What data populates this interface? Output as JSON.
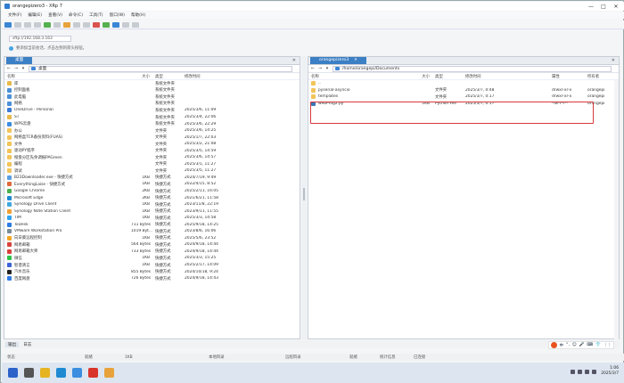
{
  "window": {
    "title": "orangepizero3 - XRp 7"
  },
  "menu": [
    "文件(F)",
    "编辑(E)",
    "查看(V)",
    "命令(C)",
    "工具(T)",
    "窗口(W)",
    "帮助(H)"
  ],
  "address": {
    "value": "sftp://192.168.3.163"
  },
  "hint": {
    "text": "要添加当前会话，点击左侧的箭头按钮。"
  },
  "left_pane": {
    "tab": "桌面",
    "path": "桌面",
    "columns": {
      "name": "名称",
      "size": "大小",
      "type": "类型",
      "modified": "修改时间"
    },
    "rows": [
      {
        "name": "库",
        "size": "",
        "type": "系统文件夹",
        "modified": "",
        "color": "#e8b84a"
      },
      {
        "name": "控制面板",
        "size": "",
        "type": "系统文件夹",
        "modified": "",
        "color": "#4a8fd8"
      },
      {
        "name": "此电脑",
        "size": "",
        "type": "系统文件夹",
        "modified": "",
        "color": "#4a8fd8"
      },
      {
        "name": "网络",
        "size": "",
        "type": "系统文件夹",
        "modified": "",
        "color": "#4a8fd8"
      },
      {
        "name": "OneDrive - Personal",
        "size": "",
        "type": "系统文件夹",
        "modified": "2025/3/6, 11:09",
        "color": "#3a7bd5"
      },
      {
        "name": "ST",
        "size": "",
        "type": "系统文件夹",
        "modified": "2025/3/4, 22:06",
        "color": "#e8b84a"
      },
      {
        "name": "WPS云盘",
        "size": "",
        "type": "系统文件夹",
        "modified": "2025/3/6, 22:29",
        "color": "#3b8ee0"
      },
      {
        "name": "办公",
        "size": "",
        "type": "文件夹",
        "modified": "2025/3/6, 14:25",
        "color": "#f2c45a"
      },
      {
        "name": "网络盒TCR备份资料(FUAS)",
        "size": "",
        "type": "文件夹",
        "modified": "2025/1/7, 22:03",
        "color": "#f2c45a"
      },
      {
        "name": "文件",
        "size": "",
        "type": "文件夹",
        "modified": "2025/3/2, 21:08",
        "color": "#f2c45a"
      },
      {
        "name": "驱动PY程序",
        "size": "",
        "type": "文件夹",
        "modified": "2025/3/5, 14:59",
        "color": "#f2c45a"
      },
      {
        "name": "橙盘分区先余调报PAGreen",
        "size": "",
        "type": "文件夹",
        "modified": "2025/3/6, 14:57",
        "color": "#f2c45a"
      },
      {
        "name": "编程",
        "size": "",
        "type": "文件夹",
        "modified": "2025/3/1, 11:27",
        "color": "#f2c45a"
      },
      {
        "name": "调试",
        "size": "",
        "type": "文件夹",
        "modified": "2025/3/5, 11:27",
        "color": "#f2c45a"
      },
      {
        "name": "B23Downloader.exe - 快捷方式",
        "size": "1KB",
        "type": "快捷方式",
        "modified": "2024/7/19, 9:49",
        "color": "#5a9ee0"
      },
      {
        "name": "EverythingLaise - 快捷方式",
        "size": "1KB",
        "type": "快捷方式",
        "modified": "2022/4/15, 8:52",
        "color": "#e06a3a"
      },
      {
        "name": "Google Chrome",
        "size": "2KB",
        "type": "快捷方式",
        "modified": "2025/2/11, 16:05",
        "color": "#4caf50"
      },
      {
        "name": "Microsoft Edge",
        "size": "2KB",
        "type": "快捷方式",
        "modified": "2021/6/21, 11:58",
        "color": "#1f8ad2"
      },
      {
        "name": "Synology Drive Client",
        "size": "1KB",
        "type": "快捷方式",
        "modified": "2023/11/8, 22:19",
        "color": "#3fa7e0"
      },
      {
        "name": "Synology Note Station Client",
        "size": "1KB",
        "type": "快捷方式",
        "modified": "2023/9/11, 11:55",
        "color": "#f0a030"
      },
      {
        "name": "TIM",
        "size": "1KB",
        "type": "快捷方式",
        "modified": "2025/3/3, 14:58",
        "color": "#2ea3f2"
      },
      {
        "name": "ToDesk",
        "size": "711 Bytes",
        "type": "快捷方式",
        "modified": "2025/9/18, 14:25",
        "color": "#2c7be5"
      },
      {
        "name": "VMware Workstation Pro",
        "size": "1019 Byt...",
        "type": "快捷方式",
        "modified": "2023/8/6, 16:06",
        "color": "#7a8a99"
      },
      {
        "name": "向日葵远程控制",
        "size": "1KB",
        "type": "快捷方式",
        "modified": "2025/5/6, 23:52",
        "color": "#f5a623"
      },
      {
        "name": "网易邮箱",
        "size": "564 Bytes",
        "type": "快捷方式",
        "modified": "2024/9/18, 14:44",
        "color": "#d9403a"
      },
      {
        "name": "网易邮箱大师",
        "size": "733 Bytes",
        "type": "快捷方式",
        "modified": "2024/9/18, 14:44",
        "color": "#d9403a"
      },
      {
        "name": "微信",
        "size": "1KB",
        "type": "快捷方式",
        "modified": "2025/3/3, 15:25",
        "color": "#2dc24a"
      },
      {
        "name": "智谱清言",
        "size": "1KB",
        "type": "快捷方式",
        "modified": "2025/2/17, 14:09",
        "color": "#3b62d8"
      },
      {
        "name": "汽水音乐",
        "size": "855 Bytes",
        "type": "快捷方式",
        "modified": "2024/10/18, 9:24",
        "color": "#222222"
      },
      {
        "name": "百度网盘",
        "size": "726 Bytes",
        "type": "快捷方式",
        "modified": "2024/9/18, 14:43",
        "color": "#2f7be5"
      }
    ]
  },
  "right_pane": {
    "tab": "orangepizero3",
    "path": "/home/orangepi/Documents",
    "columns": {
      "name": "名称",
      "size": "大小",
      "type": "类型",
      "modified": "修改时间",
      "attr": "属性",
      "owner": "所有者"
    },
    "rows": [
      {
        "name": "..",
        "size": "",
        "type": "",
        "modified": "",
        "attr": "",
        "owner": "",
        "color": "#f2c45a"
      },
      {
        "name": "pyserial-asyncio",
        "size": "",
        "type": "文件夹",
        "modified": "2025/3/7, 0:48",
        "attr": "drwxr-xr-x",
        "owner": "orangepi",
        "color": "#f2c45a"
      },
      {
        "name": "templates",
        "size": "",
        "type": "文件夹",
        "modified": "2025/3/7, 0:17",
        "attr": "drwxr-xr-x",
        "owner": "orangepi",
        "color": "#f2c45a"
      },
      {
        "name": "webProg2.py",
        "size": "1KB",
        "type": "Python File",
        "modified": "2025/3/7, 0:17",
        "attr": "-rw-r--r--",
        "owner": "orangepi",
        "color": "#3b77b5"
      }
    ]
  },
  "bottom_tabs": [
    "输出",
    "日志"
  ],
  "ime": {
    "items": [
      "中",
      "°,",
      "☺",
      "🎤",
      "⌨",
      "👕",
      "⋮⋮"
    ]
  },
  "status": {
    "left_label": "状态",
    "left_value": "就绪",
    "left_count": "1KB",
    "local_dir": "本地目录",
    "remote_label": "远程目录",
    "remote_state": "就绪",
    "stats": "统计信息",
    "conn": "已连接"
  },
  "clock": {
    "time": "1:06",
    "date": "2025/3/7"
  }
}
